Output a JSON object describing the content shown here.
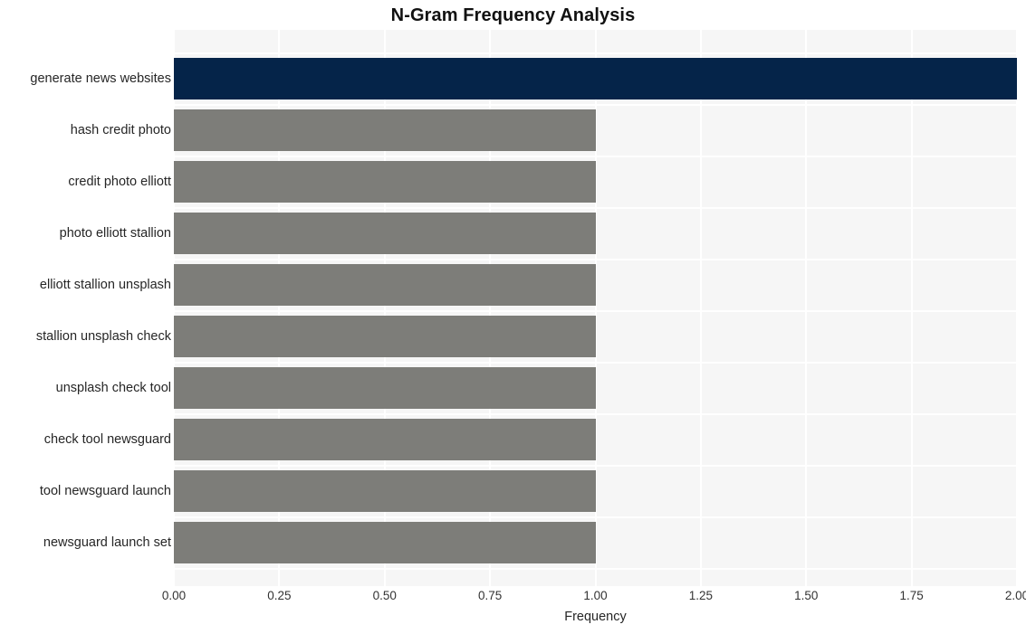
{
  "chart_data": {
    "type": "bar",
    "orientation": "horizontal",
    "title": "N-Gram Frequency Analysis",
    "xlabel": "Frequency",
    "ylabel": "",
    "xlim": [
      0,
      2.0
    ],
    "grid": true,
    "legend": null,
    "categories": [
      "generate news websites",
      "hash credit photo",
      "credit photo elliott",
      "photo elliott stallion",
      "elliott stallion unsplash",
      "stallion unsplash check",
      "unsplash check tool",
      "check tool newsguard",
      "tool newsguard launch",
      "newsguard launch set"
    ],
    "values": [
      2,
      1,
      1,
      1,
      1,
      1,
      1,
      1,
      1,
      1
    ],
    "bar_colors": [
      "#052449",
      "#7d7d79",
      "#7d7d79",
      "#7d7d79",
      "#7d7d79",
      "#7d7d79",
      "#7d7d79",
      "#7d7d79",
      "#7d7d79",
      "#7d7d79"
    ],
    "xticks": [
      "0.00",
      "0.25",
      "0.50",
      "0.75",
      "1.00",
      "1.25",
      "1.50",
      "1.75",
      "2.00"
    ],
    "xtick_values": [
      0,
      0.25,
      0.5,
      0.75,
      1.0,
      1.25,
      1.5,
      1.75,
      2.0
    ],
    "plot_background": "#f6f6f6",
    "grid_color": "#ffffff",
    "figure_background": "#ffffff",
    "highlight_color": "#052449",
    "default_bar_color": "#7d7d79"
  }
}
